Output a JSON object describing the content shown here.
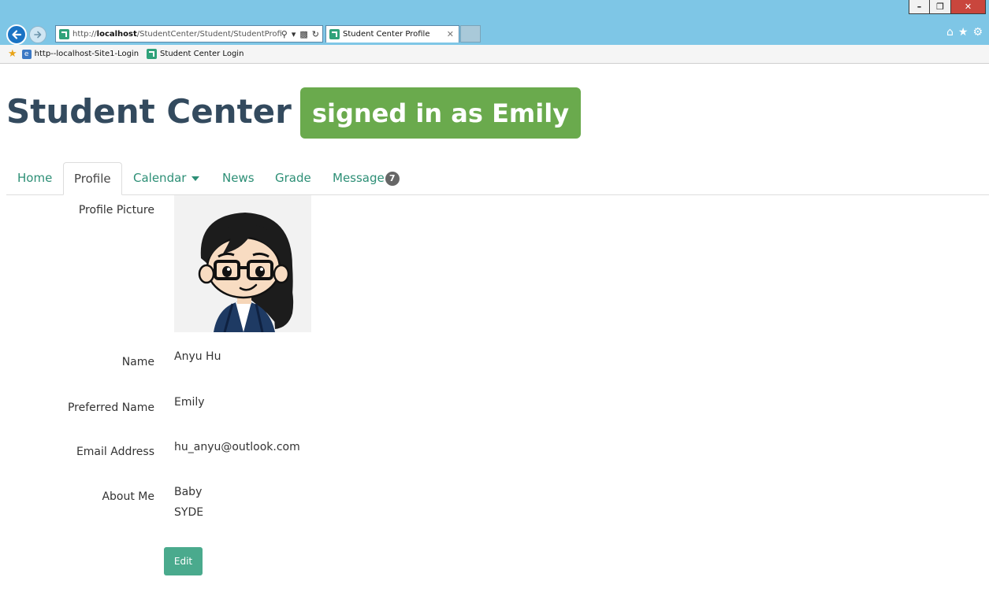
{
  "browser": {
    "url_prefix": "http://",
    "url_host": "localhost",
    "url_path": "/StudentCenter/Student/StudentProfile",
    "tab_title": "Student Center Profile",
    "favorites": [
      {
        "label": "http--localhost-Site1-Login"
      },
      {
        "label": "Student Center Login"
      }
    ]
  },
  "header": {
    "title": "Student Center",
    "signed_in": "signed in as Emily"
  },
  "nav": {
    "home": "Home",
    "profile": "Profile",
    "calendar": "Calendar",
    "news": "News",
    "grade": "Grade",
    "message": "Message",
    "message_count": "7"
  },
  "profile": {
    "picture_label": "Profile Picture",
    "name_label": "Name",
    "name_value": "Anyu Hu",
    "preferred_label": "Preferred Name",
    "preferred_value": "Emily",
    "email_label": "Email Address",
    "email_value": "hu_anyu@outlook.com",
    "about_label": "About Me",
    "about_line1": "Baby",
    "about_line2": "SYDE",
    "edit_label": "Edit"
  },
  "colors": {
    "accent": "#4aaa8d",
    "badge_green": "#6aaa4d",
    "title": "#334a5e"
  }
}
